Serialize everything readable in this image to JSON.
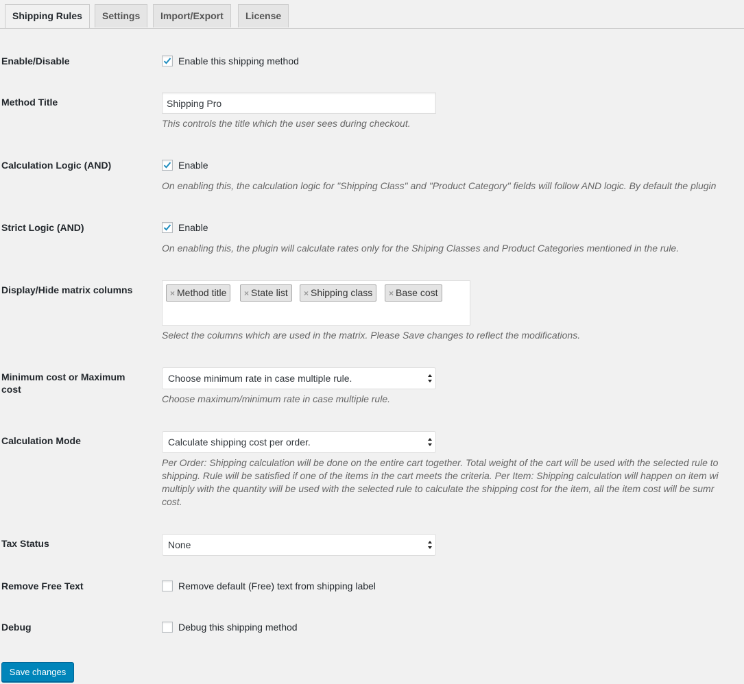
{
  "tabs": [
    {
      "label": "Shipping Rules",
      "active": true
    },
    {
      "label": "Settings",
      "active": false
    },
    {
      "label": "Import/Export",
      "active": false
    },
    {
      "label": "License",
      "active": false
    }
  ],
  "enable_disable": {
    "label": "Enable/Disable",
    "checkbox_label": "Enable this shipping method",
    "checked": true
  },
  "method_title": {
    "label": "Method Title",
    "value": "Shipping Pro",
    "description": "This controls the title which the user sees during checkout."
  },
  "calc_logic": {
    "label": "Calculation Logic (AND)",
    "checkbox_label": "Enable",
    "checked": true,
    "description": "On enabling this, the calculation logic for \"Shipping Class\" and \"Product Category\" fields will follow AND logic. By default the plugin"
  },
  "strict_logic": {
    "label": "Strict Logic (AND)",
    "checkbox_label": "Enable",
    "checked": true,
    "description": "On enabling this, the plugin will calculate rates only for the Shiping Classes and Product Categories mentioned in the rule."
  },
  "matrix_columns": {
    "label": "Display/Hide matrix columns",
    "chips": [
      "Method title",
      "State list",
      "Shipping class",
      "Base cost"
    ],
    "remove_glyph": "×",
    "description": "Select the columns which are used in the matrix. Please Save changes to reflect the modifications."
  },
  "min_max_cost": {
    "label_line1": "Minimum cost or Maximum",
    "label_line2": "cost",
    "selected": "Choose minimum rate in case multiple rule.",
    "description": "Choose maximum/minimum rate in case multiple rule."
  },
  "calc_mode": {
    "label": "Calculation Mode",
    "selected": "Calculate shipping cost per order.",
    "description_lines": [
      "Per Order: Shipping calculation will be done on the entire cart together. Total weight of the cart will be used with the selected rule to",
      "shipping. Rule will be satisfied if one of the items in the cart meets the criteria. Per Item: Shipping calculation will happen on item wi",
      "multiply with the quantity will be used with the selected rule to calculate the shipping cost for the item, all the item cost will be sumr",
      "cost."
    ]
  },
  "tax_status": {
    "label": "Tax Status",
    "selected": "None"
  },
  "remove_free_text": {
    "label": "Remove Free Text",
    "checkbox_label": "Remove default (Free) text from shipping label",
    "checked": false
  },
  "debug": {
    "label": "Debug",
    "checkbox_label": "Debug this shipping method",
    "checked": false
  },
  "save_button": {
    "label": "Save changes"
  },
  "colors": {
    "check": "#1e8cbe",
    "primary": "#0085ba",
    "background": "#f1f1f1"
  }
}
